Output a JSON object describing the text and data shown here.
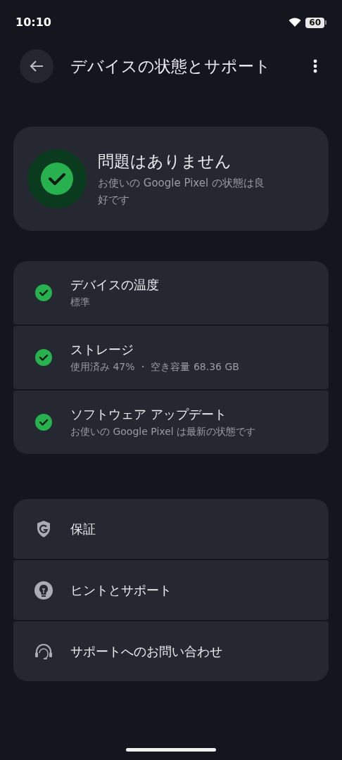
{
  "status_bar": {
    "time": "10:10",
    "battery": "60"
  },
  "header": {
    "title": "デバイスの状態とサポート"
  },
  "summary": {
    "ok": true,
    "title": "問題はありません",
    "subtitle": "お使いの Google Pixel の状態は良好です"
  },
  "checks": [
    {
      "ok": true,
      "title": "デバイスの温度",
      "subtitle": "標準"
    },
    {
      "ok": true,
      "title": "ストレージ",
      "subtitle": "使用済み 47% ・ 空き容量 68.36 GB"
    },
    {
      "ok": true,
      "title": "ソフトウェア アップデート",
      "subtitle": "お使いの Google Pixel は最新の状態です"
    }
  ],
  "support": [
    {
      "kind": "shield",
      "label": "保証"
    },
    {
      "kind": "bulb",
      "label": "ヒントとサポート"
    },
    {
      "kind": "headset",
      "label": "サポートへのお問い合わせ"
    }
  ]
}
